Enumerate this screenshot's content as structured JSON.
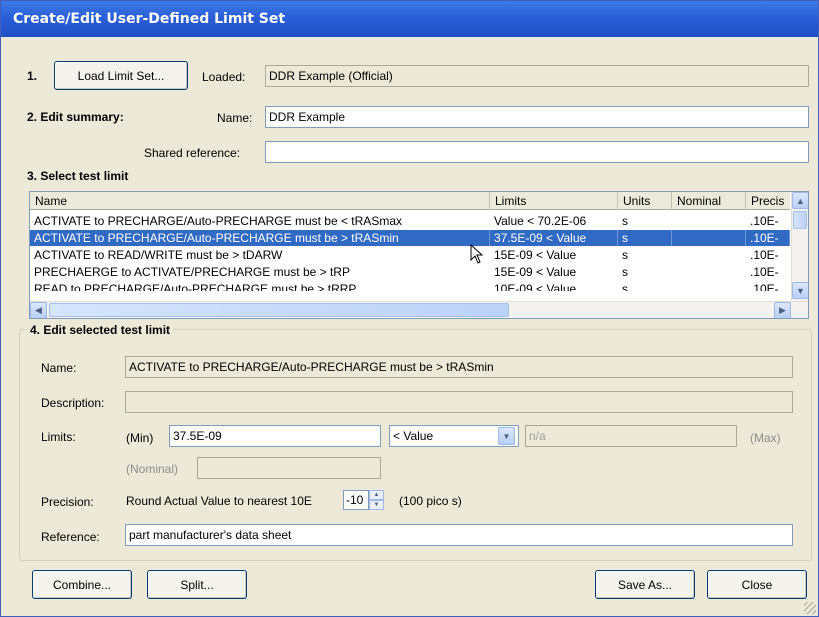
{
  "window": {
    "title": "Create/Edit User-Defined Limit Set"
  },
  "step1": {
    "number": "1.",
    "load_button": "Load Limit Set...",
    "loaded_label": "Loaded:",
    "loaded_value": "DDR Example  (Official)"
  },
  "step2": {
    "heading": "2. Edit summary:",
    "name_label": "Name:",
    "name_value": "DDR Example",
    "shared_ref_label": "Shared reference:",
    "shared_ref_value": ""
  },
  "step3": {
    "heading": "3. Select test limit",
    "columns": [
      "Name",
      "Limits",
      "Units",
      "Nominal",
      "Precis"
    ],
    "rows": [
      {
        "name": "ACTIVATE to PRECHARGE/Auto-PRECHARGE must be < tRASmax",
        "limits": "Value < 70.2E-06",
        "units": "s",
        "nominal": "",
        "precision": ".10E-"
      },
      {
        "name": "ACTIVATE to PRECHARGE/Auto-PRECHARGE must be > tRASmin",
        "limits": "37.5E-09 < Value",
        "units": "s",
        "nominal": "",
        "precision": ".10E-"
      },
      {
        "name": "ACTIVATE to READ/WRITE must be > tDARW",
        "limits": "15E-09 < Value",
        "units": "s",
        "nominal": "",
        "precision": ".10E-"
      },
      {
        "name": "PRECHAERGE to ACTIVATE/PRECHARGE must be > tRP",
        "limits": "15E-09 < Value",
        "units": "s",
        "nominal": "",
        "precision": ".10E-"
      },
      {
        "name": "READ to PRECHARGE/Auto-PRECHARGE must be > tRRP",
        "limits": "10E-09 < Value",
        "units": "s",
        "nominal": "",
        "precision": ".10E-"
      }
    ],
    "selected_index": 1
  },
  "step4": {
    "heading": "4. Edit selected test limit",
    "name_label": "Name:",
    "name_value": "ACTIVATE to PRECHARGE/Auto-PRECHARGE must be > tRASmin",
    "description_label": "Description:",
    "description_value": "",
    "limits_label": "Limits:",
    "min_label": "(Min)",
    "min_value": "37.5E-09",
    "operator_value": "< Value",
    "max_value": "n/a",
    "max_label": "(Max)",
    "nominal_label": "(Nominal)",
    "nominal_value": "",
    "precision_label": "Precision:",
    "precision_text": "Round Actual Value to nearest 10E",
    "precision_value": "-10",
    "precision_note": "(100 pico s)",
    "reference_label": "Reference:",
    "reference_value": "part manufacturer's data sheet"
  },
  "buttons": {
    "combine": "Combine...",
    "split": "Split...",
    "save_as": "Save As...",
    "close": "Close"
  },
  "icons": {
    "scroll_up": "scroll-up-arrow-icon",
    "scroll_down": "scroll-down-arrow-icon",
    "scroll_left": "scroll-left-arrow-icon",
    "scroll_right": "scroll-right-arrow-icon",
    "dropdown": "dropdown-arrow-icon",
    "spinner": "spinner-icon",
    "resize": "resize-grip-icon"
  }
}
